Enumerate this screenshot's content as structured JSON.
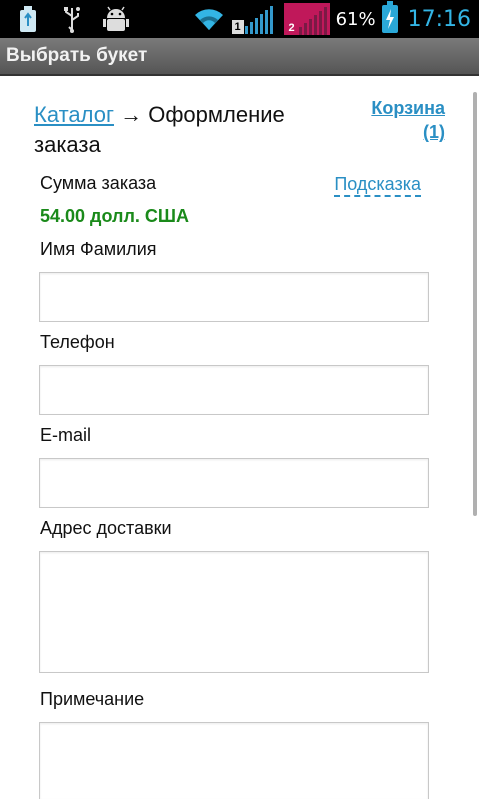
{
  "status_bar": {
    "sim1": "1",
    "sim2": "2",
    "battery_percent": "61%",
    "time": "17:16",
    "icons": [
      "usb-icon",
      "usb-debug-icon",
      "android-debug-icon",
      "wifi-icon",
      "signal-sim1-icon",
      "signal-sim2-icon",
      "battery-charging-icon"
    ],
    "accent_color": "#33b5e5"
  },
  "app": {
    "title": "Выбрать букет"
  },
  "breadcrumb": {
    "catalog": "Каталог",
    "arrow": " → ",
    "current": "Оформление заказа"
  },
  "cart": {
    "label": "Корзина",
    "count": "(1)"
  },
  "order": {
    "sum_label": "Сумма заказа",
    "hint_label": "Подсказка",
    "sum_value": "54.00 долл. США",
    "sum_color": "#1a8a1a"
  },
  "form": {
    "name_label": "Имя Фамилия",
    "name_value": "",
    "phone_label": "Телефон",
    "phone_value": "",
    "email_label": "E-mail",
    "email_value": "",
    "address_label": "Адрес доставки",
    "address_value": "",
    "note_label": "Примечание",
    "note_value": ""
  }
}
